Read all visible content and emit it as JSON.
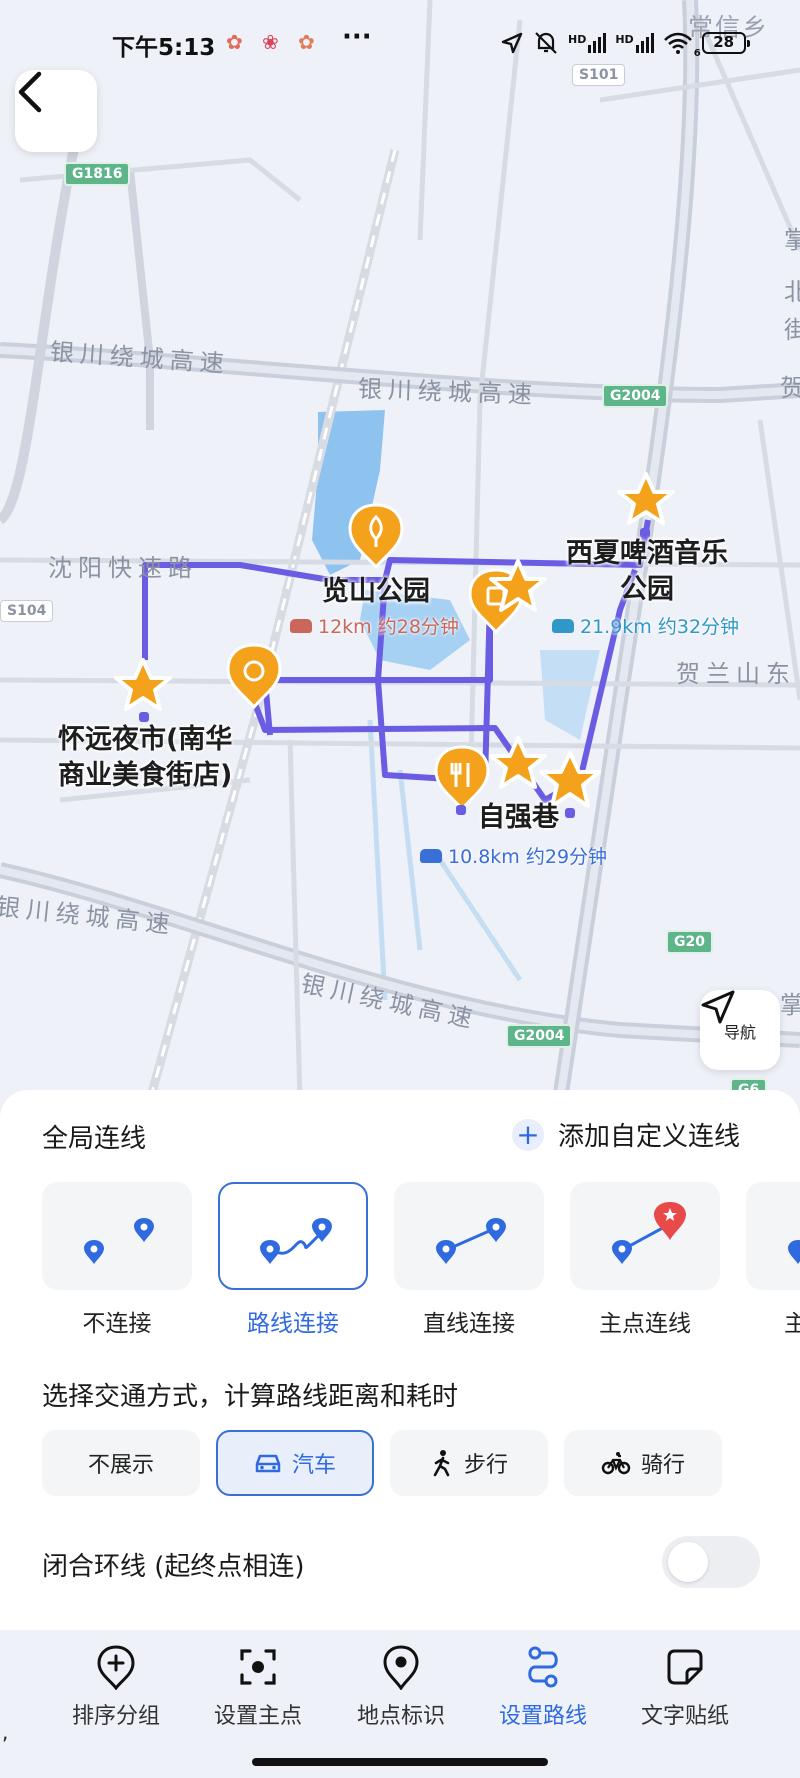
{
  "status": {
    "time": "下午5:13",
    "dots": "···",
    "hd1": "HD",
    "hd2": "HD",
    "wifi_sub": "6",
    "battery": "28"
  },
  "map": {
    "corner_text": "常信乡",
    "road_labels": [
      "银川绕城高速",
      "银川绕城高速",
      "沈阳快速路",
      "银川绕城高速",
      "银川绕城高速",
      "贺兰山东"
    ],
    "shields": [
      "G1816",
      "S101",
      "G2004",
      "S104",
      "G20",
      "G2004",
      "G6"
    ],
    "edge_chars": [
      "掌",
      "北",
      "街",
      "贺",
      "掌"
    ],
    "pois": [
      {
        "name": "览山公园",
        "icon": "tree-icon"
      },
      {
        "name": "西夏啤酒音乐公园",
        "line1": "西夏啤酒音乐",
        "line2": "公园",
        "icon": "star-icon"
      },
      {
        "name": "怀远夜市(南华商业美食街店)",
        "line1": "怀远夜市(南华",
        "line2": "商业美食街店)",
        "icon": "star-icon"
      },
      {
        "name": "自强巷",
        "icon": "star-icon"
      }
    ],
    "route_tags": [
      {
        "text": "12km 约28分钟",
        "color": "#c9675a"
      },
      {
        "text": "21.9km 约32分钟",
        "color": "#2f98c9"
      },
      {
        "text": "10.8km 约29分钟",
        "color": "#3a6fd8"
      }
    ],
    "nav_label": "导航"
  },
  "panel": {
    "title": "全局连线",
    "add_custom": "添加自定义连线",
    "options": [
      {
        "label": "不连接",
        "selected": false
      },
      {
        "label": "路线连接",
        "selected": true
      },
      {
        "label": "直线连接",
        "selected": false
      },
      {
        "label": "主点连线",
        "selected": false
      },
      {
        "label": "主",
        "selected": false
      }
    ],
    "transport_title": "选择交通方式，计算路线距离和耗时",
    "modes": [
      {
        "label": "不展示",
        "icon": "",
        "selected": false
      },
      {
        "label": "汽车",
        "icon": "car-icon",
        "selected": true
      },
      {
        "label": "步行",
        "icon": "walk-icon",
        "selected": false
      },
      {
        "label": "骑行",
        "icon": "bike-icon",
        "selected": false
      }
    ],
    "loop_label": "闭合环线 (起终点相连)",
    "loop_on": false
  },
  "tabs": [
    {
      "label": "排序分组",
      "icon": "add-location-icon",
      "selected": false
    },
    {
      "label": "设置主点",
      "icon": "focus-icon",
      "selected": false
    },
    {
      "label": "地点标识",
      "icon": "location-pin-icon",
      "selected": false
    },
    {
      "label": "设置路线",
      "icon": "route-icon",
      "selected": true
    },
    {
      "label": "文字贴纸",
      "icon": "sticker-icon",
      "selected": false
    }
  ],
  "stray_char": ","
}
